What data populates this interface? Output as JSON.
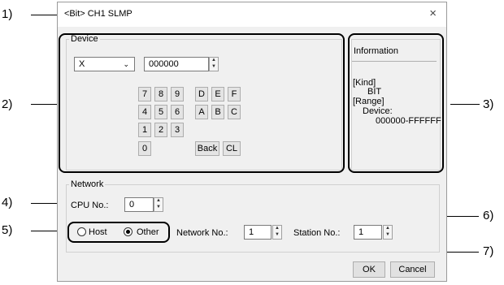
{
  "callouts": [
    "1)",
    "2)",
    "3)",
    "4)",
    "5)",
    "6)",
    "7)"
  ],
  "dialog": {
    "title": "<Bit> CH1 SLMP",
    "close_glyph": "×"
  },
  "device": {
    "group_label": "Device",
    "type_value": "X",
    "address_value": "000000",
    "keys": [
      "7",
      "8",
      "9",
      "D",
      "E",
      "F",
      "4",
      "5",
      "6",
      "A",
      "B",
      "C",
      "1",
      "2",
      "3",
      "0",
      "Back",
      "CL"
    ]
  },
  "information": {
    "title": "Information",
    "kind_label": "[Kind]",
    "kind_value": "BIT",
    "range_label": "[Range]",
    "device_label": "Device:",
    "range_value": "000000-FFFFFF"
  },
  "network": {
    "group_label": "Network",
    "cpu_label": "CPU No.:",
    "cpu_value": "0",
    "host_label": "Host",
    "other_label": "Other",
    "selected": "Other",
    "network_no_label": "Network No.:",
    "network_no_value": "1",
    "station_no_label": "Station No.:",
    "station_no_value": "1"
  },
  "buttons": {
    "ok": "OK",
    "cancel": "Cancel"
  }
}
